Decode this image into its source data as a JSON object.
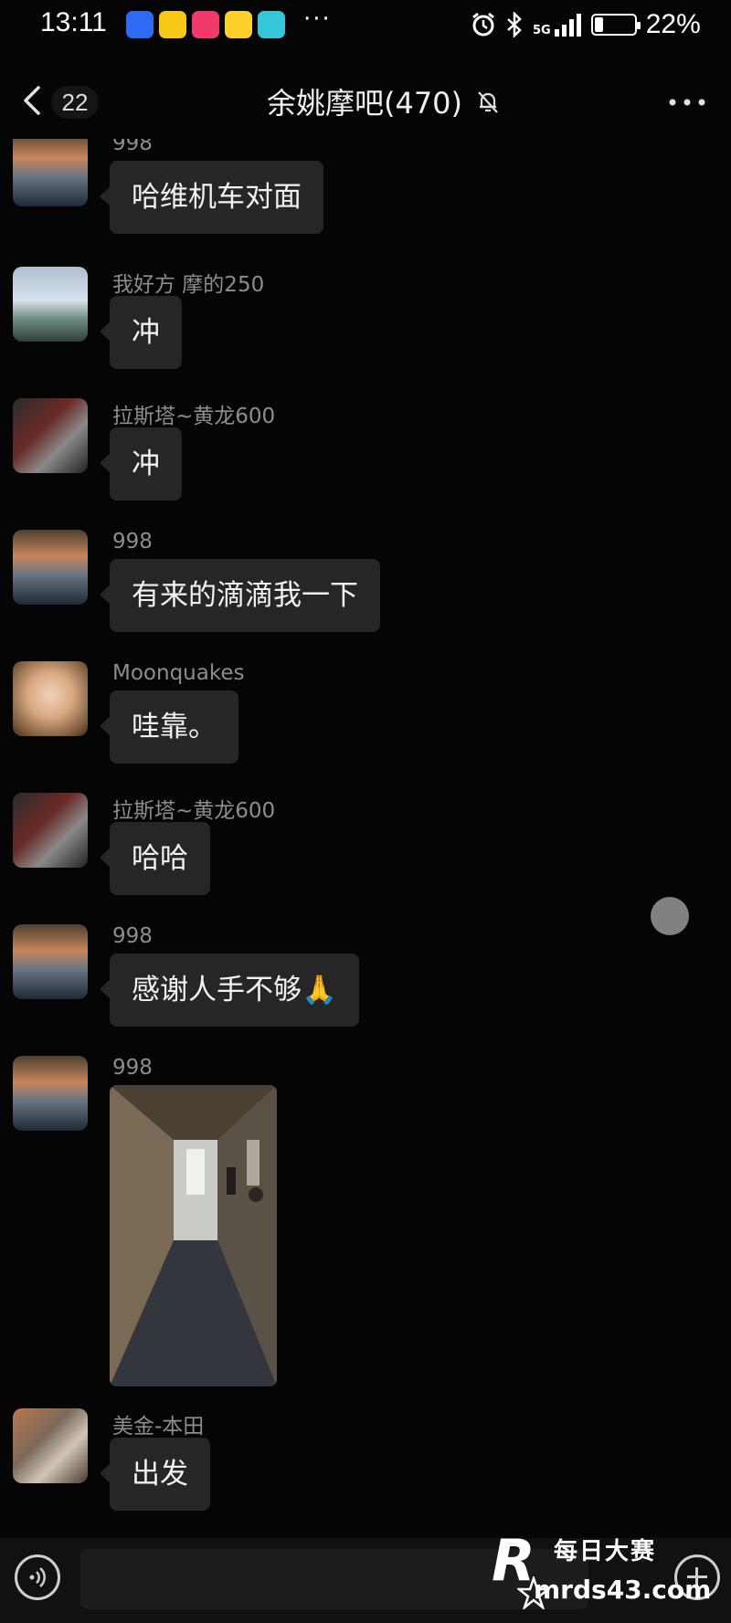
{
  "status_bar": {
    "time": "13:11",
    "more": "···",
    "network": "5G",
    "battery_percent": "22%",
    "battery_level": 0.22
  },
  "header": {
    "back_count": "22",
    "title": "余姚摩吧(470)"
  },
  "messages": [
    {
      "sender": "998",
      "text": "哈维机车对面",
      "type": "text"
    },
    {
      "sender": "我好方 摩的250",
      "text": "冲",
      "type": "text"
    },
    {
      "sender": "拉斯塔~黄龙600",
      "text": "冲",
      "type": "text"
    },
    {
      "sender": "998",
      "text": "有来的滴滴我一下",
      "type": "text"
    },
    {
      "sender": "Moonquakes",
      "text": "哇靠。",
      "type": "text"
    },
    {
      "sender": "拉斯塔~黄龙600",
      "text": "哈哈",
      "type": "text"
    },
    {
      "sender": "998",
      "text": "感谢人手不够🙏",
      "type": "text"
    },
    {
      "sender": "998",
      "type": "image",
      "image": "hallway-photo"
    },
    {
      "sender": "美金-本田",
      "text": "出发",
      "type": "text"
    }
  ],
  "watermark": {
    "logo": "R",
    "brand": "每日大赛",
    "url": "mrds43.com"
  },
  "colors": {
    "background": "#050505",
    "bubble": "#262626",
    "sender": "#8d8d8d"
  }
}
